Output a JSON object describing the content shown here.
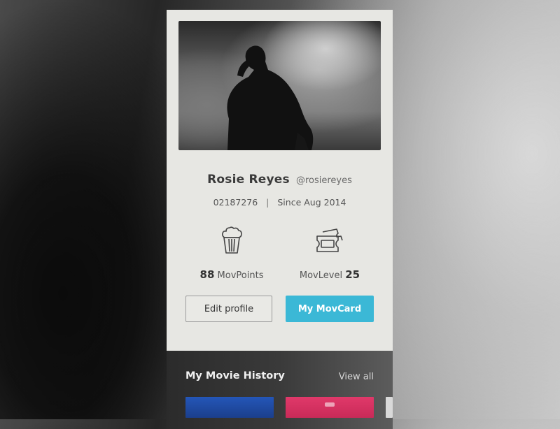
{
  "profile": {
    "name": "Rosie Reyes",
    "handle": "@rosiereyes",
    "member_id": "02187276",
    "separator": "|",
    "since": "Since Aug 2014"
  },
  "stats": {
    "points": {
      "value": "88",
      "label": "MovPoints",
      "icon": "popcorn-icon"
    },
    "level": {
      "label": "MovLevel",
      "value": "25",
      "icon": "ticket-icon"
    }
  },
  "buttons": {
    "edit_profile": "Edit profile",
    "my_movcard": "My MovCard"
  },
  "history": {
    "title": "My Movie History",
    "view_all": "View all"
  },
  "colors": {
    "accent": "#3bb8d6",
    "card_bg": "#e7e7e3",
    "poster_blue": "#2456b8",
    "poster_pink": "#e0396a"
  }
}
